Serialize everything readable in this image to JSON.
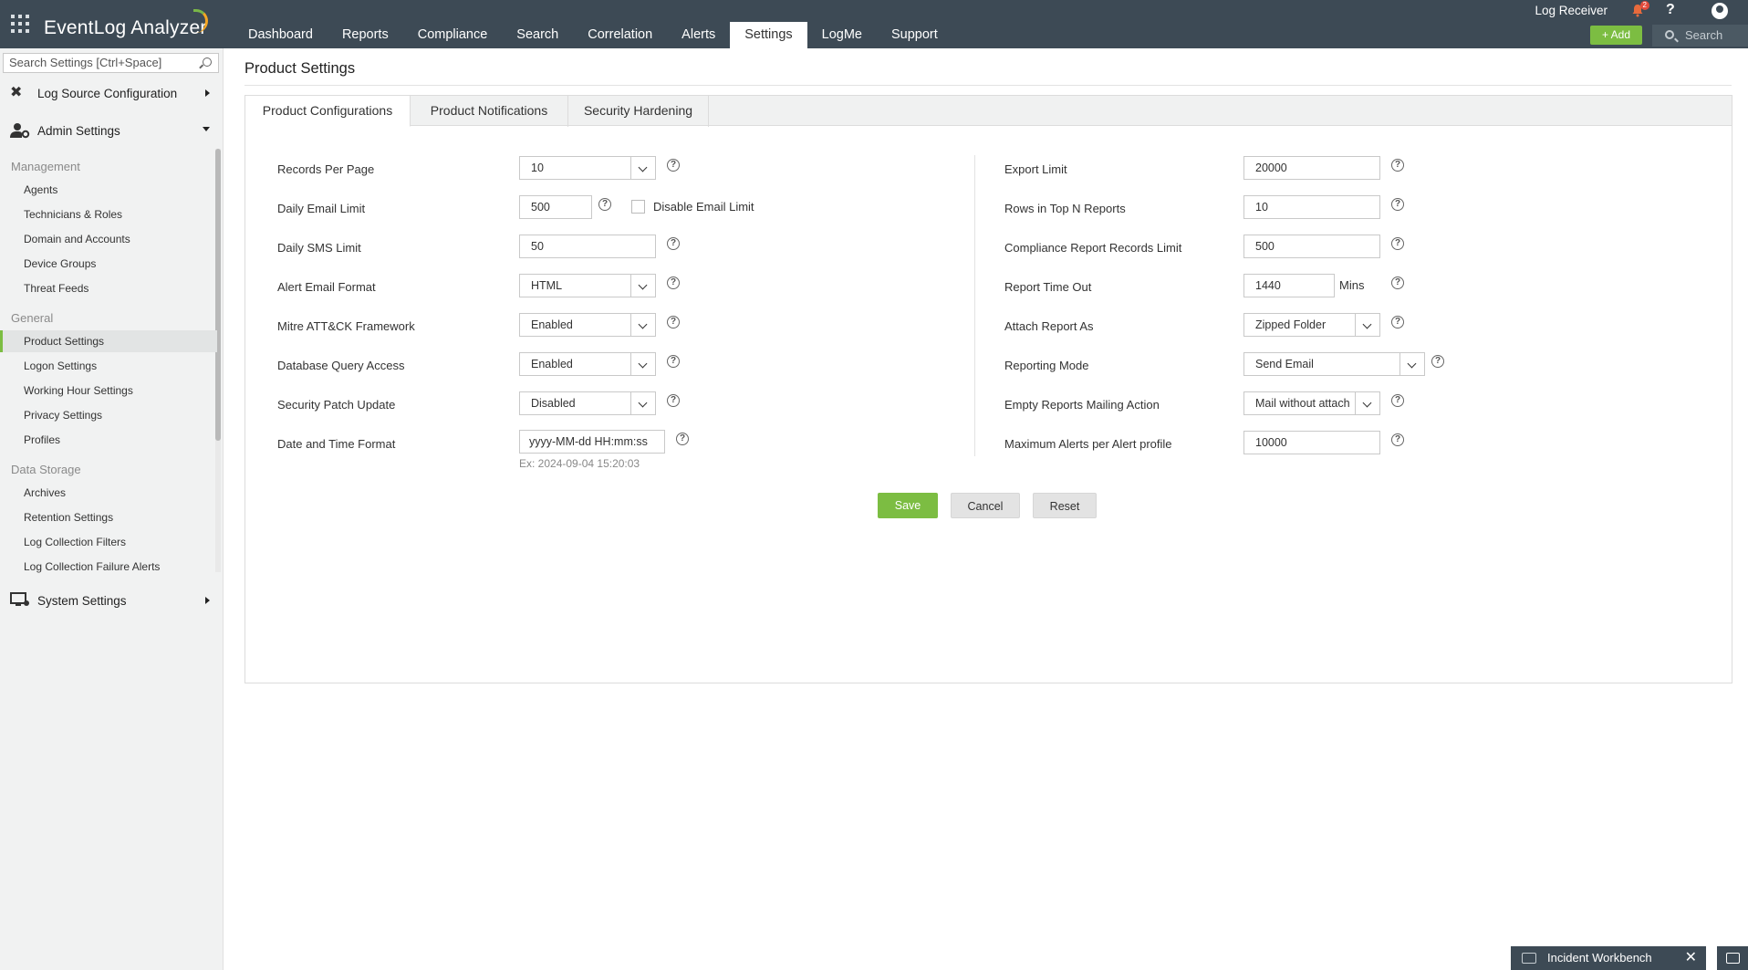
{
  "app": {
    "name": "EventLog Analyzer"
  },
  "nav": [
    "Dashboard",
    "Reports",
    "Compliance",
    "Search",
    "Correlation",
    "Alerts",
    "Settings",
    "LogMe",
    "Support"
  ],
  "topbar": {
    "log_receiver": "Log Receiver",
    "notif_count": "2",
    "help": "?",
    "add_label": "Add",
    "search_placeholder": "Search"
  },
  "sidebar": {
    "search_placeholder": "Search Settings [Ctrl+Space]",
    "log_source": "Log Source Configuration",
    "admin": "Admin Settings",
    "system": "System Settings",
    "cat_management": "Management",
    "cat_general": "General",
    "cat_storage": "Data Storage",
    "management": [
      "Agents",
      "Technicians & Roles",
      "Domain and Accounts",
      "Device Groups",
      "Threat Feeds"
    ],
    "general": [
      "Product Settings",
      "Logon Settings",
      "Working Hour Settings",
      "Privacy Settings",
      "Profiles"
    ],
    "storage": [
      "Archives",
      "Retention Settings",
      "Log Collection Filters",
      "Log Collection Failure Alerts"
    ]
  },
  "page": {
    "title": "Product Settings"
  },
  "tabs": [
    "Product Configurations",
    "Product Notifications",
    "Security Hardening"
  ],
  "left": {
    "records_per_page": {
      "label": "Records Per Page",
      "value": "10"
    },
    "daily_email_limit": {
      "label": "Daily Email Limit",
      "value": "500",
      "disable_label": "Disable Email Limit"
    },
    "daily_sms_limit": {
      "label": "Daily SMS Limit",
      "value": "50"
    },
    "alert_email_format": {
      "label": "Alert Email Format",
      "value": "HTML"
    },
    "mitre": {
      "label": "Mitre ATT&CK Framework",
      "value": "Enabled"
    },
    "db_query": {
      "label": "Database Query Access",
      "value": "Enabled"
    },
    "patch_update": {
      "label": "Security Patch Update",
      "value": "Disabled"
    },
    "date_format": {
      "label": "Date and Time Format",
      "value": "yyyy-MM-dd HH:mm:ss",
      "example": "Ex: 2024-09-04 15:20:03"
    }
  },
  "right": {
    "export_limit": {
      "label": "Export Limit",
      "value": "20000"
    },
    "rows_top_n": {
      "label": "Rows in Top N Reports",
      "value": "10"
    },
    "compliance_limit": {
      "label": "Compliance Report Records Limit",
      "value": "500"
    },
    "report_timeout": {
      "label": "Report Time Out",
      "value": "1440",
      "unit": "Mins"
    },
    "attach_as": {
      "label": "Attach Report As",
      "value": "Zipped Folder"
    },
    "reporting_mode": {
      "label": "Reporting Mode",
      "value": "Send Email"
    },
    "empty_reports": {
      "label": "Empty Reports Mailing Action",
      "value": "Mail without attach"
    },
    "max_alerts": {
      "label": "Maximum Alerts per Alert profile",
      "value": "10000"
    }
  },
  "buttons": {
    "save": "Save",
    "cancel": "Cancel",
    "reset": "Reset"
  },
  "footer": {
    "workbench": "Incident Workbench",
    "close": "✕"
  },
  "colors": {
    "topbar": "#3d4a55",
    "accent": "#7cbd42"
  }
}
